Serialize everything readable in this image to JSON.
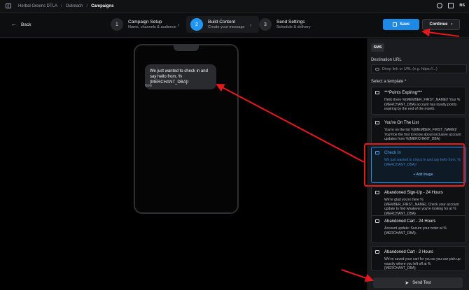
{
  "topbar": {
    "breadcrumbs": [
      "Herbal Greens DTLA",
      "Outreach",
      "Campaigns"
    ],
    "avatar_initials": "BS"
  },
  "header": {
    "back_label": "Back",
    "steps": [
      {
        "num": "1",
        "title": "Campaign Setup",
        "subtitle": "Name, channels & audience"
      },
      {
        "num": "2",
        "title": "Build Content",
        "subtitle": "Create your message"
      },
      {
        "num": "3",
        "title": "Send Settings",
        "subtitle": "Schedule & delivery"
      }
    ],
    "save_label": "Save",
    "continue_label": "Continue"
  },
  "preview": {
    "message": "We just wanted to check in and say hello from, %{MERCHANT_DBA}!",
    "time": "Now"
  },
  "panel": {
    "tab": "SMS",
    "destination_label": "Destination URL",
    "destination_placeholder": "Deep link or URL (e.g. https://...)",
    "template_label": "Select a template *",
    "templates": [
      {
        "name": "***Points Expiring***",
        "body": "Hello there %{MEMBER_FIRST_NAME}! Your %{MERCHANT_DBA} account has loyalty points expiring by the end of the month."
      },
      {
        "name": "You're On The List",
        "body": "You're on the list %{MEMBER_FIRST_NAME}! You'll be the first to know about exclusive account updates from %{MERCHANT_DBA}"
      },
      {
        "name": "Check In",
        "body": "We just wanted to check in and say hello from, %{MERCHANT_DBA}!",
        "add_image": "+ Add image"
      },
      {
        "name": "Abandoned Sign-Up - 24 Hours",
        "body": "We're glad you're here %{MEMBER_FIRST_NAME}. Check your account update to find whatever you're looking for at %{MERCHANT_DBA}"
      },
      {
        "name": "Abandoned Cart - 24 Hours",
        "body": "Account update: Secure your order at %{MERCHANT_DBA}."
      },
      {
        "name": "Abandoned Cart - 2 Hours",
        "body": "We've saved your cart for you so you can pick up exactly where you left off at %{MERCHANT_DBA}"
      }
    ],
    "send_test_label": "Send Test"
  },
  "colors": {
    "accent": "#1e88e5",
    "annotation": "#e3191c"
  }
}
